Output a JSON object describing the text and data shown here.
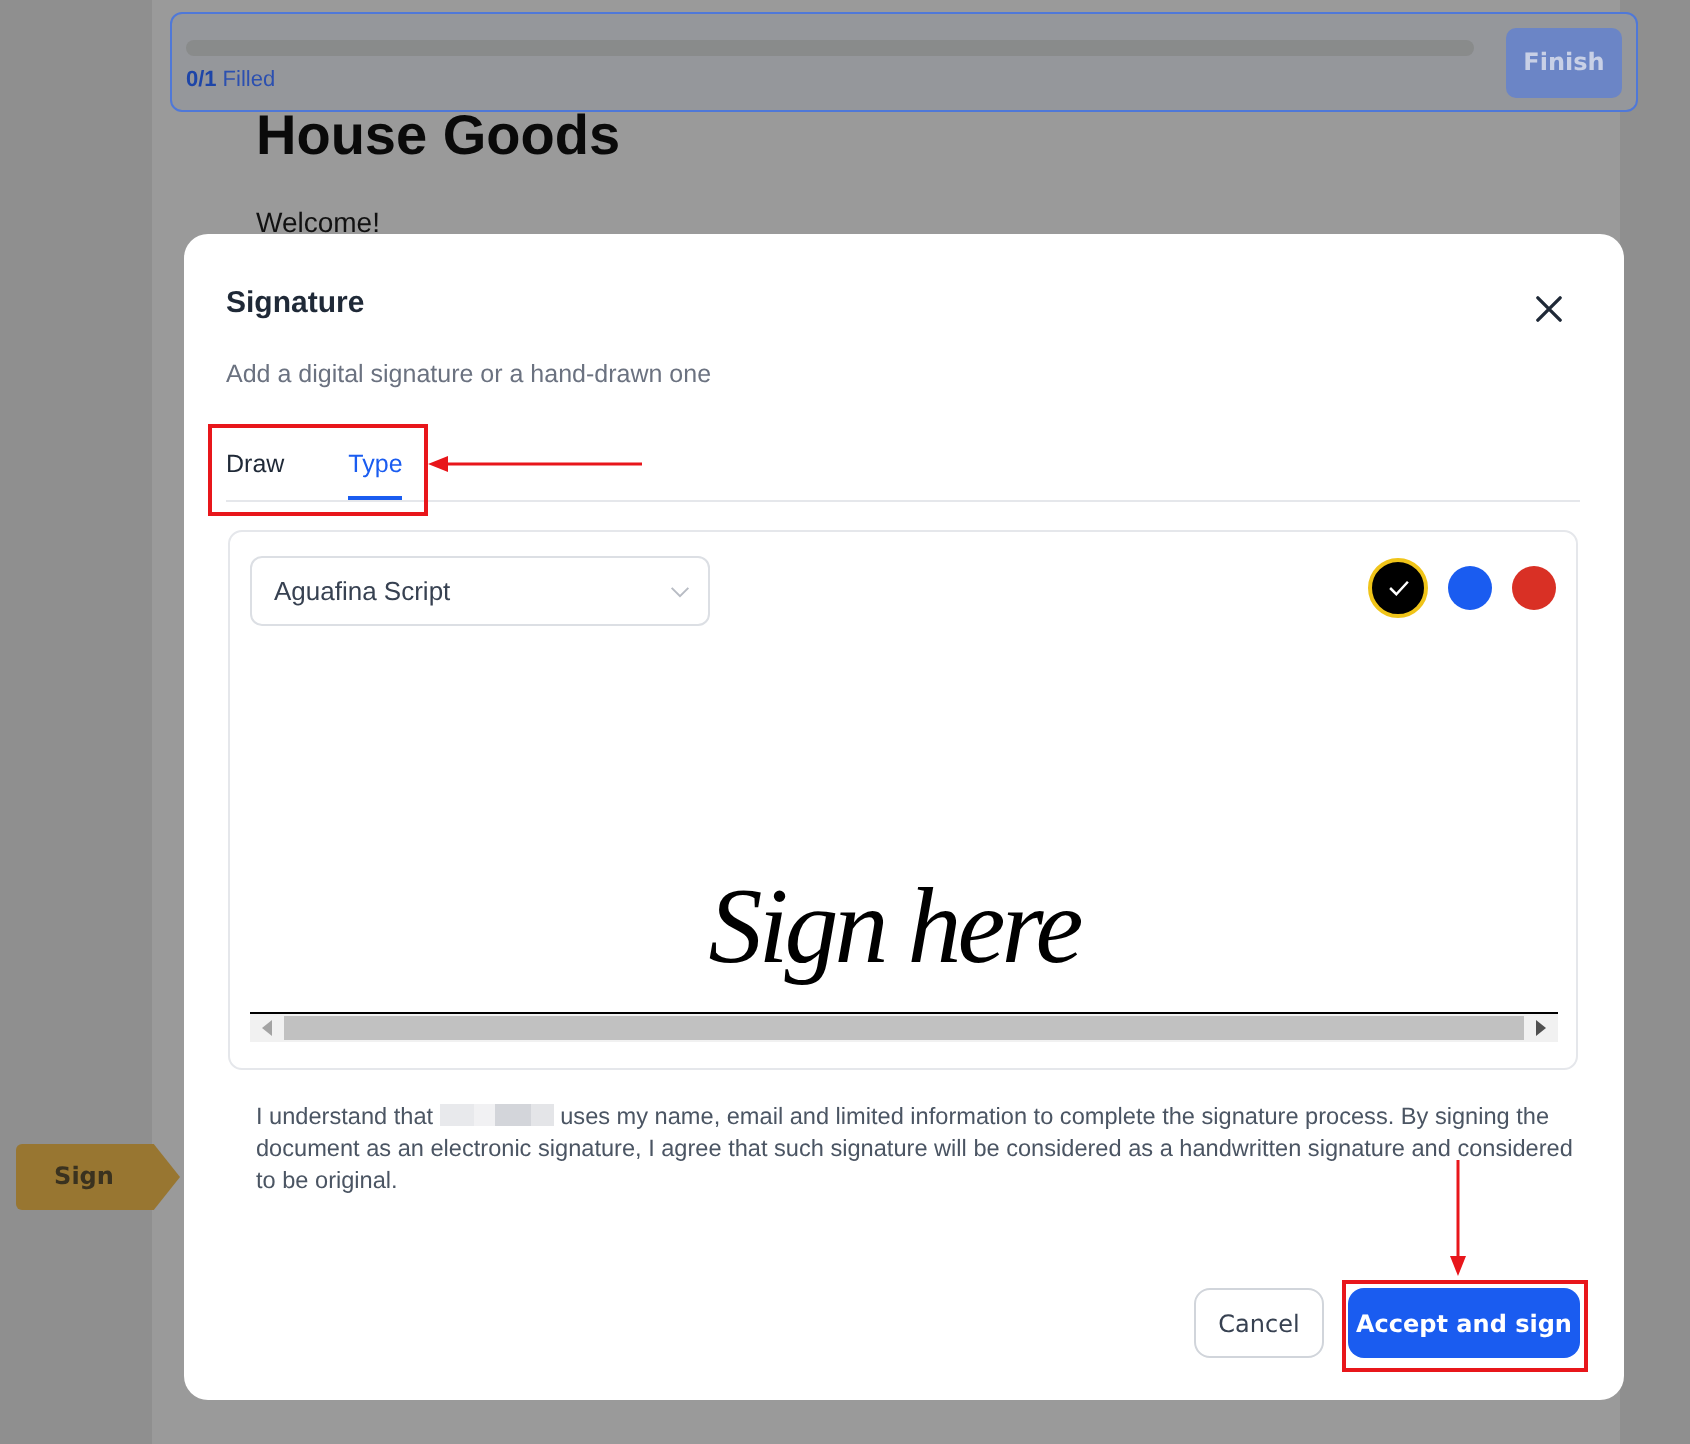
{
  "toolbar": {
    "progress": {
      "level": 0,
      "count": "0/1",
      "label": "Filled"
    },
    "finish_button": {
      "label": "Finish",
      "disabled": true
    }
  },
  "document": {
    "title": "House Goods",
    "greeting": "Welcome!",
    "sign_tag": {
      "label": "Sign"
    }
  },
  "dialog": {
    "title": "Signature",
    "subtitle": "Add a digital signature or a hand-drawn one",
    "tabs": [
      {
        "label": "Draw",
        "selected": false
      },
      {
        "label": "Type",
        "selected": true
      }
    ],
    "font_select": {
      "value": "Aguafina Script"
    },
    "colors": [
      {
        "color": "#000000",
        "selected": true
      },
      {
        "color": "#1a5cf0",
        "selected": false
      },
      {
        "color": "#d93025",
        "selected": false
      }
    ],
    "signature_preview": "Sign here",
    "consent": {
      "before": "I understand that",
      "after": "uses my name, email and limited information to complete the signature process. By signing the document as an electronic signature, I agree that such signature will be considered as a handwritten signature and considered to be original."
    },
    "buttons": [
      {
        "label": "Cancel",
        "kind": "secondary"
      },
      {
        "label": "Accept and sign",
        "kind": "primary"
      }
    ]
  }
}
